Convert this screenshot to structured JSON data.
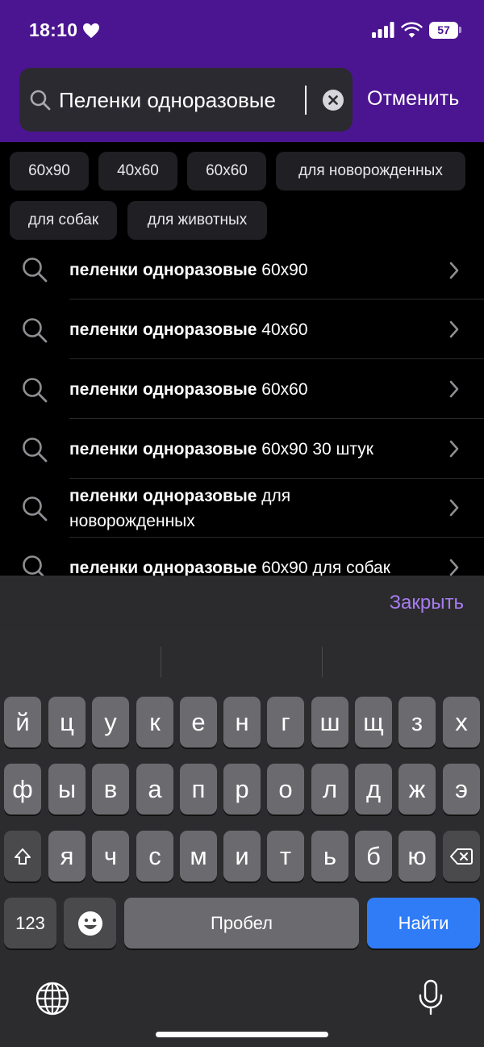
{
  "status": {
    "time": "18:10",
    "battery": "57"
  },
  "search": {
    "value": "Пеленки одноразовые",
    "cancel_label": "Отменить"
  },
  "chips": [
    "60x90",
    "40x60",
    "60x60",
    "для новорожденных",
    "для собак",
    "для животных"
  ],
  "suggestions": [
    {
      "bold": "пеленки одноразовые",
      "rest": " 60x90"
    },
    {
      "bold": "пеленки одноразовые",
      "rest": " 40x60"
    },
    {
      "bold": "пеленки одноразовые",
      "rest": " 60x60"
    },
    {
      "bold": "пеленки одноразовые",
      "rest": " 60x90 30 штук"
    },
    {
      "bold": "пеленки одноразовые",
      "rest": " для новорожденных"
    },
    {
      "bold": "пеленки одноразовые",
      "rest": " 60x90 для собак"
    }
  ],
  "keyboard": {
    "close_label": "Закрыть",
    "row1": [
      "й",
      "ц",
      "у",
      "к",
      "е",
      "н",
      "г",
      "ш",
      "щ",
      "з",
      "х"
    ],
    "row2": [
      "ф",
      "ы",
      "в",
      "а",
      "п",
      "р",
      "о",
      "л",
      "д",
      "ж",
      "э"
    ],
    "row3": [
      "я",
      "ч",
      "с",
      "м",
      "и",
      "т",
      "ь",
      "б",
      "ю"
    ],
    "numbers_label": "123",
    "space_label": "Пробел",
    "return_label": "Найти",
    "icons": [
      "shift-icon",
      "backspace-icon",
      "emoji-icon",
      "globe-icon",
      "microphone-icon"
    ]
  },
  "colors": {
    "header": "#4b1591",
    "accent": "#a77cf0",
    "return_key": "#2f7cf6"
  }
}
